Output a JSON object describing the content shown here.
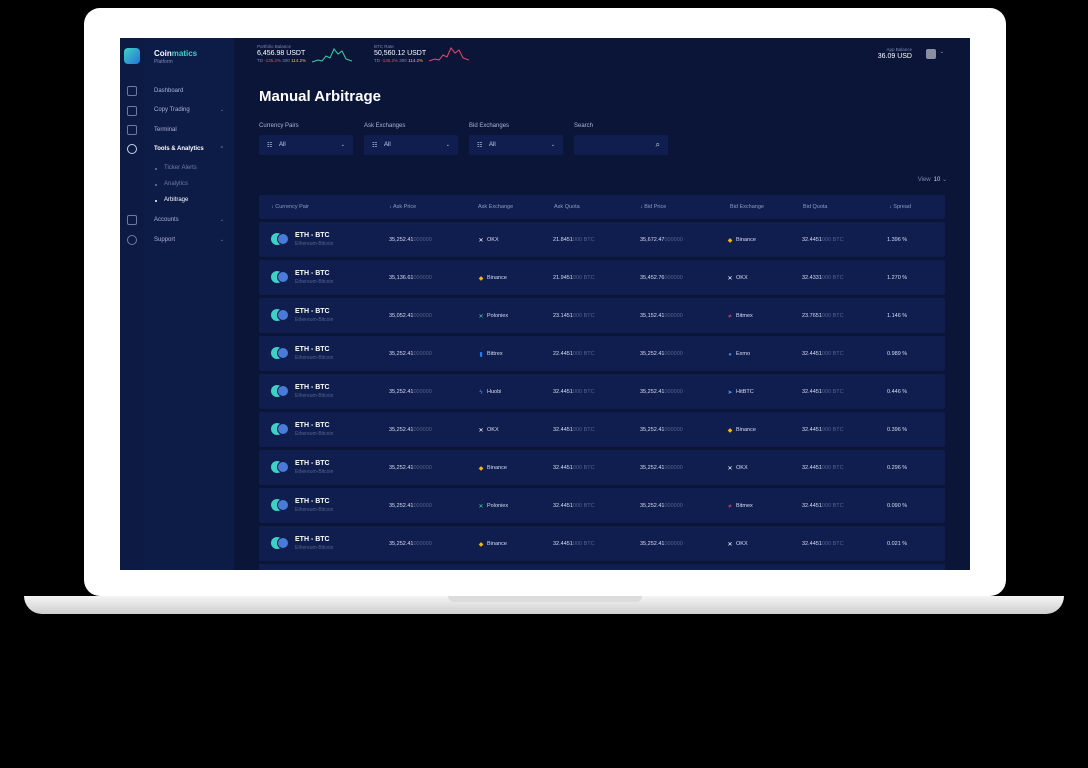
{
  "brand": {
    "name_part1": "Coin",
    "name_part2": "matics",
    "subtitle": "Platform"
  },
  "sidebar": {
    "items": [
      {
        "label": "Dashboard",
        "chevron": ""
      },
      {
        "label": "Copy Trading",
        "chevron": "⌄"
      },
      {
        "label": "Terminal",
        "chevron": ""
      },
      {
        "label": "Tools & Analytics",
        "chevron": "⌃"
      },
      {
        "label": "Accounts",
        "chevron": "⌄"
      },
      {
        "label": "Support",
        "chevron": "⌄"
      }
    ],
    "sub_items": [
      {
        "label": "Ticker Alerts"
      },
      {
        "label": "Analytics"
      },
      {
        "label": "Arbitrage"
      }
    ]
  },
  "topbar": {
    "portfolio": {
      "label": "Portfolio Balance",
      "value": "6,456.98 USDT",
      "period": "TD",
      "neg": "-135.2%",
      "mid": "300",
      "pos": "114.2%"
    },
    "btc": {
      "label": "BTC Rate",
      "value": "50,560.12 USDT",
      "period": "TD",
      "neg": "-135.2%",
      "mid": "300",
      "pos": "114.2%"
    },
    "app_balance": {
      "label": "App Balance",
      "value": "36.09 USD"
    }
  },
  "page": {
    "title": "Manual Arbitrage",
    "filters": [
      {
        "label": "Currency Pairs",
        "value": "All"
      },
      {
        "label": "Ask Exchanges",
        "value": "All"
      },
      {
        "label": "Bid Exchanges",
        "value": "All"
      }
    ],
    "search": {
      "label": "Search",
      "placeholder": ""
    },
    "view": {
      "label": "View",
      "value": "10"
    }
  },
  "table": {
    "headers": [
      "↓ Currency Pair",
      "↓ Ask Price",
      "Ask Exchange",
      "Ask Quota",
      "↓ Bid Price",
      "Bid Exchange",
      "Bid Quota",
      "↓ Spread"
    ],
    "rows": [
      {
        "pair": "ETH - BTC",
        "sub": "Ethereum-Bitcoin",
        "ask_price": "35,252.41",
        "ask_price_dim": "000000",
        "ask_ex": "OKX",
        "ask_quota": "21.8451",
        "ask_quota_dim": "000 BTC",
        "bid_price": "35,672.47",
        "bid_price_dim": "000000",
        "bid_ex": "Binance",
        "bid_quota": "32.4451",
        "bid_quota_dim": "000 BTC",
        "spread": "1.396 %"
      },
      {
        "pair": "ETH - BTC",
        "sub": "Ethereum-Bitcoin",
        "ask_price": "35,136.61",
        "ask_price_dim": "000000",
        "ask_ex": "Binance",
        "ask_quota": "21.9451",
        "ask_quota_dim": "000 BTC",
        "bid_price": "35,452.76",
        "bid_price_dim": "000000",
        "bid_ex": "OKX",
        "bid_quota": "32.4331",
        "bid_quota_dim": "000 BTC",
        "spread": "1.270 %"
      },
      {
        "pair": "ETH - BTC",
        "sub": "Ethereum-Bitcoin",
        "ask_price": "35,052.41",
        "ask_price_dim": "000000",
        "ask_ex": "Poloniex",
        "ask_quota": "23.1451",
        "ask_quota_dim": "000 BTC",
        "bid_price": "35,152.41",
        "bid_price_dim": "000000",
        "bid_ex": "Bitmex",
        "bid_quota": "23.7651",
        "bid_quota_dim": "000 BTC",
        "spread": "1.146 %"
      },
      {
        "pair": "ETH - BTC",
        "sub": "Ethereum-Bitcoin",
        "ask_price": "35,252.41",
        "ask_price_dim": "000000",
        "ask_ex": "Bittrex",
        "ask_quota": "22.4451",
        "ask_quota_dim": "000 BTC",
        "bid_price": "35,252.41",
        "bid_price_dim": "000000",
        "bid_ex": "Exmo",
        "bid_quota": "32.4451",
        "bid_quota_dim": "000 BTC",
        "spread": "0.989 %"
      },
      {
        "pair": "ETH - BTC",
        "sub": "Ethereum-Bitcoin",
        "ask_price": "35,252.41",
        "ask_price_dim": "000000",
        "ask_ex": "Huobi",
        "ask_quota": "32.4451",
        "ask_quota_dim": "000 BTC",
        "bid_price": "35,252.41",
        "bid_price_dim": "000000",
        "bid_ex": "HitBTC",
        "bid_quota": "32.4451",
        "bid_quota_dim": "000 BTC",
        "spread": "0.446 %"
      },
      {
        "pair": "ETH - BTC",
        "sub": "Ethereum-Bitcoin",
        "ask_price": "35,252.41",
        "ask_price_dim": "000000",
        "ask_ex": "OKX",
        "ask_quota": "32.4451",
        "ask_quota_dim": "000 BTC",
        "bid_price": "35,252.41",
        "bid_price_dim": "000000",
        "bid_ex": "Binance",
        "bid_quota": "32.4451",
        "bid_quota_dim": "000 BTC",
        "spread": "0.396 %"
      },
      {
        "pair": "ETH - BTC",
        "sub": "Ethereum-Bitcoin",
        "ask_price": "35,252.41",
        "ask_price_dim": "000000",
        "ask_ex": "Binance",
        "ask_quota": "32.4451",
        "ask_quota_dim": "000 BTC",
        "bid_price": "35,252.41",
        "bid_price_dim": "000000",
        "bid_ex": "OKX",
        "bid_quota": "32.4451",
        "bid_quota_dim": "000 BTC",
        "spread": "0.296 %"
      },
      {
        "pair": "ETH - BTC",
        "sub": "Ethereum-Bitcoin",
        "ask_price": "35,252.41",
        "ask_price_dim": "000000",
        "ask_ex": "Poloniex",
        "ask_quota": "32.4451",
        "ask_quota_dim": "000 BTC",
        "bid_price": "35,252.41",
        "bid_price_dim": "000000",
        "bid_ex": "Bitmex",
        "bid_quota": "32.4451",
        "bid_quota_dim": "000 BTC",
        "spread": "0.090 %"
      },
      {
        "pair": "ETH - BTC",
        "sub": "Ethereum-Bitcoin",
        "ask_price": "35,252.41",
        "ask_price_dim": "000000",
        "ask_ex": "Binance",
        "ask_quota": "32.4451",
        "ask_quota_dim": "000 BTC",
        "bid_price": "35,252.41",
        "bid_price_dim": "000000",
        "bid_ex": "OKX",
        "bid_quota": "32.4451",
        "bid_quota_dim": "000 BTC",
        "spread": "0.021 %"
      }
    ]
  },
  "exchange_icons": {
    "OKX": {
      "glyph": "✕",
      "color": "#ffffff"
    },
    "Binance": {
      "glyph": "◆",
      "color": "#f0b90b"
    },
    "Poloniex": {
      "glyph": "✕",
      "color": "#3fd1a5"
    },
    "Bittrex": {
      "glyph": "▮",
      "color": "#2f7bff"
    },
    "Huobi": {
      "glyph": "ϟ",
      "color": "#5b8def"
    },
    "Bitmex": {
      "glyph": "≠",
      "color": "#e94a6a"
    },
    "Exmo": {
      "glyph": "●",
      "color": "#2f7bff"
    },
    "HitBTC": {
      "glyph": "➤",
      "color": "#5b8def"
    }
  },
  "colors": {
    "background": "#0a1538",
    "panel": "#0f1e4e",
    "accent": "#3fd1c5",
    "negative": "#e94a6a",
    "positive_spark": "#3fd1a5"
  }
}
